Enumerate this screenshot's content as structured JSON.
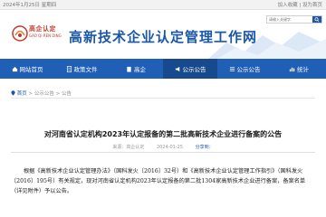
{
  "topbar": {
    "date": "2024年1月25日 星期四",
    "links": "加入收藏 | 设为首页"
  },
  "header": {
    "logo_text": "高企认定",
    "logo_sub": "GAO QI REN DING",
    "site_title": "高新技术企业认定管理工作网",
    "search_placeholder": "请输入关键字"
  },
  "nav": {
    "items": [
      {
        "label": "网站首页",
        "icon": "home-icon"
      },
      {
        "label": "政策文件",
        "icon": "document-icon"
      },
      {
        "label": "高企",
        "icon": "building-icon"
      },
      {
        "label": "公示公告",
        "icon": "megaphone-icon",
        "active": true
      },
      {
        "label": "公示公告",
        "icon": "list-icon"
      },
      {
        "label": "统计",
        "icon": "chart-icon"
      }
    ]
  },
  "breadcrumb": {
    "home": "首页",
    "sep": ">",
    "level1": "公示公告",
    "level2": "公告"
  },
  "article": {
    "title": "对河南省认定机构2023年认定报备的第二批高新技术企业进行备案的公告",
    "source": "来源：高企认定",
    "date": "2024-01-25",
    "share": "分享到：",
    "paragraph": "根据《高新技术企业认定管理办法》（国科发火〔2016〕32号）和《高新技术企业认定管理工作指引》（国科发火〔2016〕195号）有关规定，现对河南省认定机构2023年认定报备的第二批1304家高新技术企业进行备案，备案名单（详见附件）予以公告。"
  },
  "colors": {
    "primary": "#1f5fb5",
    "nav_active": "#17498d",
    "logo_red": "#c0392b"
  }
}
